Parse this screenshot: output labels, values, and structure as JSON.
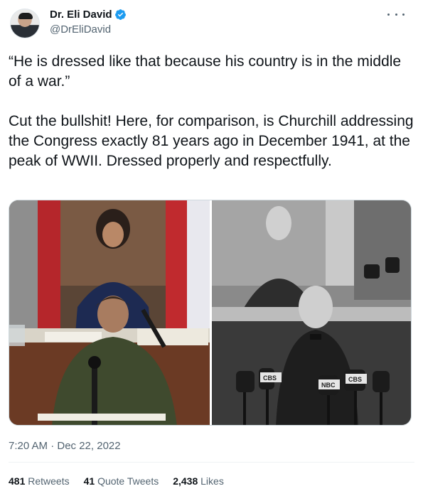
{
  "author": {
    "name": "Dr. Eli David",
    "handle": "@DrEliDavid",
    "verified": true
  },
  "more_icon": "more-dots-icon",
  "tweet": {
    "text": "“He is dressed like that because his country is in the middle of a war.”\n\nCut the bullshit! Here, for comparison, is Churchill addressing the Congress exactly 81 years ago in December 1941, at the peak of WWII. Dressed properly and respectfully."
  },
  "media": {
    "count": 2,
    "left_overlay_labels": [],
    "right_overlay_labels": [
      "CBS",
      "NBC",
      "CBS",
      "CBS"
    ]
  },
  "timestamp": "7:20 AM · Dec 22, 2022",
  "stats": [
    {
      "count": "481",
      "label": " Retweets"
    },
    {
      "count": "41",
      "label": " Quote Tweets"
    },
    {
      "count": "2,438",
      "label": " Likes"
    }
  ],
  "colors": {
    "verified": "#1d9bf0",
    "text": "#0f1419",
    "secondary": "#536471"
  }
}
